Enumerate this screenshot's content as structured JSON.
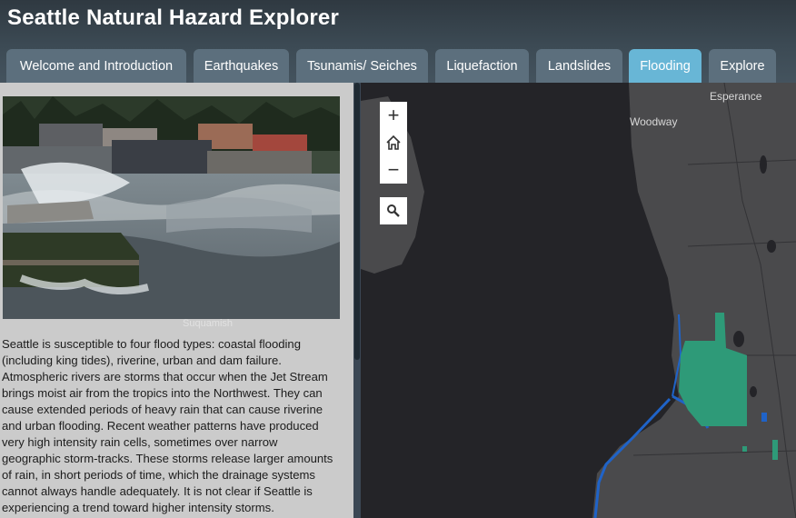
{
  "app": {
    "title": "Seattle Natural Hazard Explorer"
  },
  "tabs": [
    {
      "label": "Welcome and Introduction",
      "active": false
    },
    {
      "label": "Earthquakes",
      "active": false
    },
    {
      "label": "Tsunamis/ Seiches",
      "active": false
    },
    {
      "label": "Liquefaction",
      "active": false
    },
    {
      "label": "Landslides",
      "active": false
    },
    {
      "label": "Flooding",
      "active": true
    },
    {
      "label": "Explore",
      "active": false
    }
  ],
  "panel": {
    "photo_credit": "Suquamish",
    "body": "Seattle is susceptible to four flood types: coastal flooding (including king tides), riverine, urban and dam failure. Atmospheric rivers are storms that occur when the Jet Stream brings moist air from the tropics into the Northwest. They can cause extended periods of heavy rain that can cause riverine and urban flooding. Recent weather patterns have produced very high intensity rain cells, sometimes over narrow geographic storm-tracks. These storms release larger amounts of rain, in short periods of time, which the drainage systems cannot always handle adequately. It is not clear if Seattle is experiencing a trend toward higher intensity storms."
  },
  "map": {
    "labels": {
      "esperance": "Esperance",
      "woodway": "Woodway"
    },
    "controls": {
      "zoom_in": "+",
      "zoom_out": "−"
    },
    "colors": {
      "water": "#242428",
      "land": "#4a4a4c",
      "flood_zone": "#2e9a78",
      "river": "#1f63c8"
    }
  }
}
